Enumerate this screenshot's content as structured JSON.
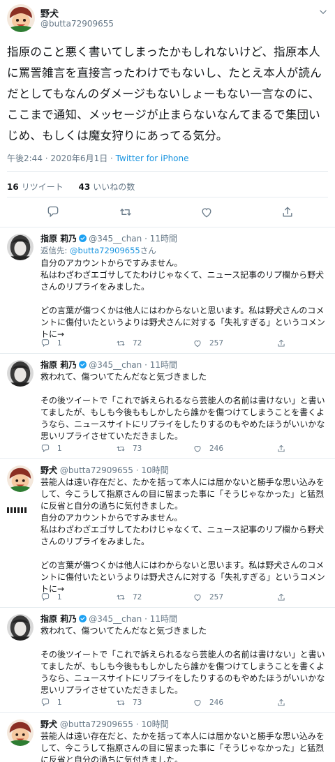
{
  "main_tweet": {
    "display_name": "野犬",
    "handle": "@butta72909655",
    "text": "指原のこと悪く書いてしまったかもしれないけど、指原本人に罵詈雑言を直接言ったわけでもないし、たとえ本人が読んだとしてもなんのダメージもないしょーもない一言なのに、ここまで通知、メッセージが止まらないなんてまるで集団いじめ、もしくは魔女狩りにあってる気分。",
    "timestamp": "午後2:44 · 2020年6月1日 · ",
    "via": "Twitter for iPhone",
    "retweets_count": "16",
    "retweets_label": "リツイート",
    "likes_count": "43",
    "likes_label": "いいねの数"
  },
  "replies": [
    {
      "display_name": "指原 莉乃",
      "handle_time": "@345__chan · 11時間",
      "reply_to_prefix": "返信先: ",
      "reply_to_mention": "@butta72909655",
      "reply_to_suffix": "さん",
      "text": "自分のアカウントからですみません。\n私はわざわざエゴサしてたわけじゃなくて、ニュース記事のリプ欄から野犬さんのリプライをみました。\n\nどの言葉が傷つくかは他人にはわからないと思います。私は野犬さんのコメントに傷付いたというよりは野犬さんに対する「失礼すぎる」というコメントに→",
      "replies": "1",
      "retweets": "72",
      "likes": "257"
    },
    {
      "display_name": "指原 莉乃",
      "handle_time": "@345__chan · 11時間",
      "text": "救われて、傷ついてたんだなと気づきました\n\nその後ツイートで「これで訴えられるなら芸能人の名前は書けない」と書いてましたが、もしも今後ももしかしたら誰かを傷つけてしまうことを書くようなら、ニュースサイトにリプライをしたりするのもやめたほうがいいかな思いリプライさせていただきました。",
      "replies": "1",
      "retweets": "73",
      "likes": "246"
    },
    {
      "display_name": "野犬",
      "handle_time": "@butta72909655 · 10時間",
      "text": "芸能人は遠い存在だと、たかを括って本人には届かないと勝手な思い込みをして、今こうして指原さんの目に留まった事に「そうじゃなかった」と猛烈に反省と自分の過ちに気付きました。",
      "quoted_text": "自分のアカウントからですみません。\n私はわざわざエゴサしてたわけじゃなくて、ニュース記事のリプ欄から野犬さんのリプライをみました。\n\nどの言葉が傷つくかは他人にはわからないと思います。私は野犬さんのコメントに傷付いたというよりは野犬さんに対する「失礼すぎる」というコメントに→",
      "replies": "1",
      "retweets": "72",
      "likes": "257"
    },
    {
      "display_name": "指原 莉乃",
      "handle_time": "@345__chan · 11時間",
      "text": "救われて、傷ついてたんだなと気づきました\n\nその後ツイートで「これで訴えられるなら芸能人の名前は書けない」と書いてましたが、もしも今後ももしかしたら誰かを傷つけてしまうことを書くようなら、ニュースサイトにリプライをしたりするのもやめたほうがいいかな思いリプライさせていただきました。",
      "replies": "1",
      "retweets": "73",
      "likes": "246"
    },
    {
      "display_name": "野犬",
      "handle_time": "@butta72909655 · 10時間",
      "text": "芸能人は遠い存在だと、たかを括って本人には届かないと勝手な思い込みをして、今こうして指原さんの目に留まった事に「そうじゃなかった」と猛烈に反省と自分の過ちに気付きました。"
    }
  ],
  "colors": {
    "text": "#14171a",
    "secondary": "#657786",
    "link": "#1b95e0",
    "verified": "#1da1f2",
    "border": "#e6ecf0"
  }
}
